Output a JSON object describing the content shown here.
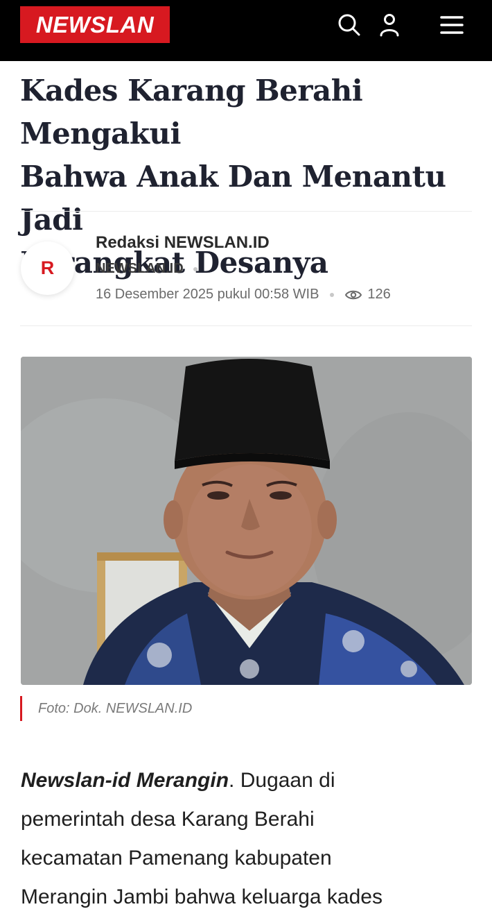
{
  "header": {
    "logo_text": "NEWSLAN",
    "logo_color": "#d71920",
    "bar_color": "#000000",
    "icons": [
      "search-icon",
      "user-icon",
      "menu-icon"
    ]
  },
  "article": {
    "title_line1": "Kades Karang Berahi Mengakui",
    "title_line2": "Bahwa Anak Dan Menantu Jadi",
    "title_line3": "Perangkat Desanya",
    "author": {
      "avatar_letter": "R",
      "name": "Redaksi NEWSLAN.ID",
      "site": "NEWSLAN.ID",
      "date": "16 Desember 2025 pukul 00:58 WIB",
      "views": "126"
    },
    "photo_caption": "Foto: Dok. NEWSLAN.ID",
    "lead": "Newslan-id Merangin",
    "body_line1": ". Dugaan di",
    "body_line2": "pemerintah desa Karang Berahi",
    "body_line3": "kecamatan Pamenang kabupaten",
    "body_line4": "Merangin Jambi bahwa keluarga kades"
  }
}
